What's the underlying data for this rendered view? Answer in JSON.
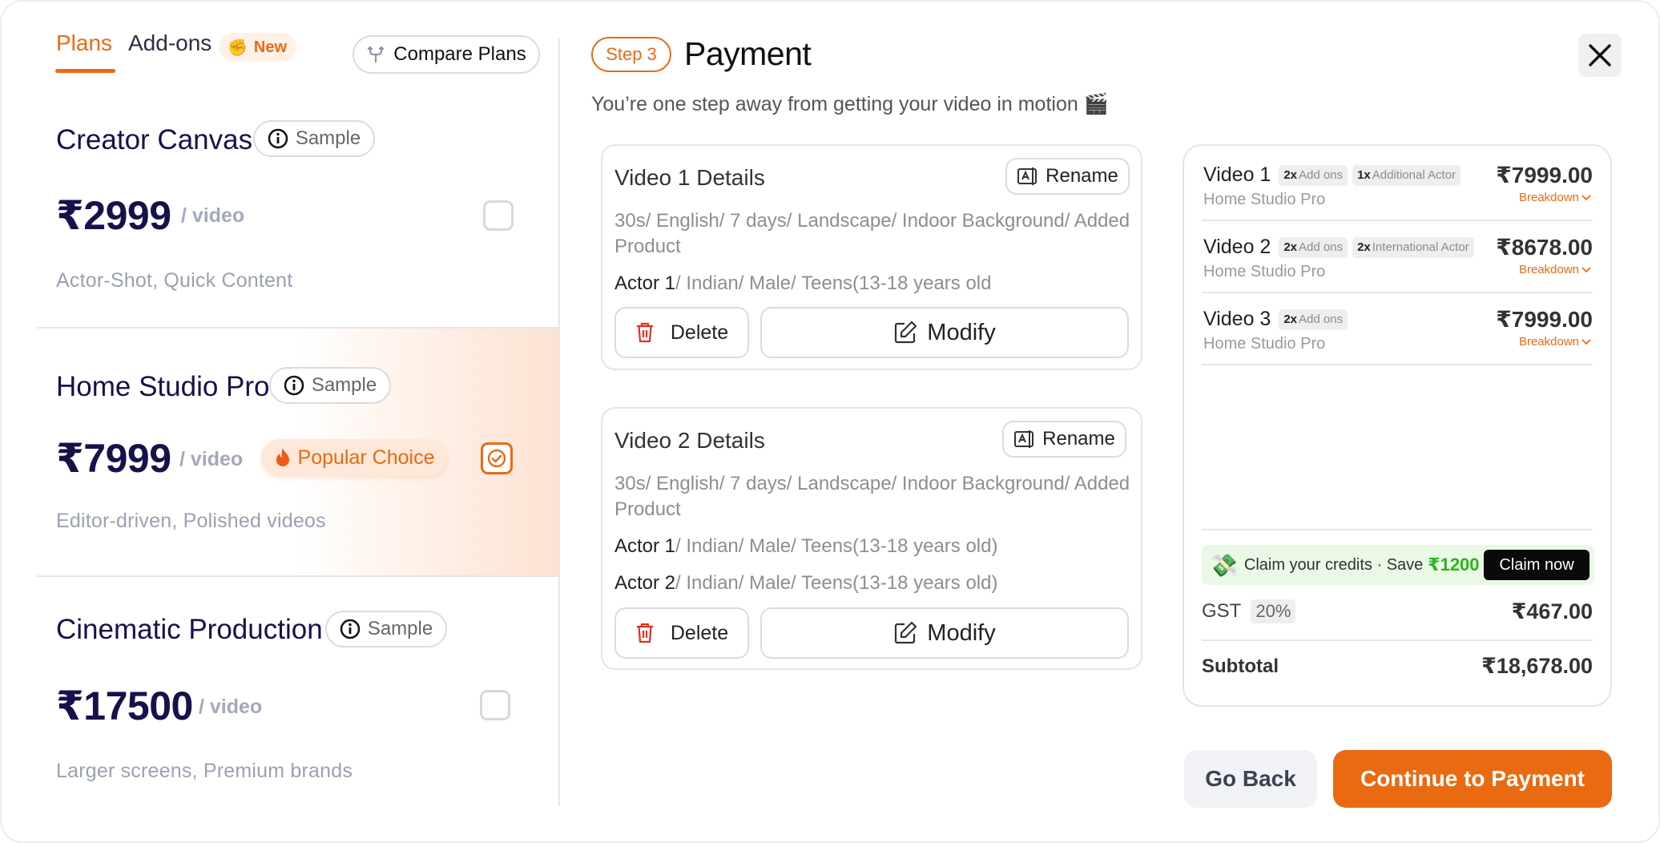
{
  "tabs": {
    "plans": "Plans",
    "addons": "Add-ons",
    "new_badge": "New"
  },
  "compare_label": "Compare Plans",
  "sample_label": "Sample",
  "per_video": "/ video",
  "popular_label": "Popular Choice",
  "plans": [
    {
      "name": "Creator Canvas",
      "price": "₹2999",
      "desc": "Actor-Shot, Quick Content",
      "selected": false
    },
    {
      "name": "Home Studio Pro",
      "price": "₹7999",
      "desc": "Editor-driven, Polished videos",
      "selected": true
    },
    {
      "name": "Cinematic Production",
      "price": "₹17500",
      "desc": "Larger screens, Premium brands",
      "selected": false
    }
  ],
  "header": {
    "step": "Step 3",
    "title": "Payment",
    "subtitle": "You’re one step away from getting your video in motion 🎬"
  },
  "videos": [
    {
      "title": "Video 1 Details",
      "spec_line1": "30s/ English/ 7 days/ Landscape/ Indoor Background/ Added",
      "spec_line2": "Product",
      "actors": [
        {
          "label": "Actor 1",
          "detail": "/ Indian/ Male/ Teens(13-18 years old"
        }
      ]
    },
    {
      "title": "Video 2 Details",
      "spec_line1": "30s/ English/ 7 days/ Landscape/ Indoor Background/ Added",
      "spec_line2": "Product",
      "actors": [
        {
          "label": "Actor 1",
          "detail": "/ Indian/ Male/ Teens(13-18 years old)"
        },
        {
          "label": "Actor 2",
          "detail": "/ Indian/ Male/ Teens(13-18 years old)"
        }
      ]
    }
  ],
  "buttons": {
    "rename": "Rename",
    "delete": "Delete",
    "modify": "Modify",
    "go_back": "Go Back",
    "continue": "Continue to Payment",
    "claim": "Claim now"
  },
  "summary": {
    "items": [
      {
        "name": "Video 1",
        "plan": "Home Studio Pro",
        "price": "₹7999.00",
        "chips": [
          {
            "count": "2x",
            "label": "Add ons"
          },
          {
            "count": "1x",
            "label": "Additional Actor"
          }
        ],
        "breakdown": "Breakdown"
      },
      {
        "name": "Video 2",
        "plan": "Home Studio Pro",
        "price": "₹8678.00",
        "chips": [
          {
            "count": "2x",
            "label": "Add ons"
          },
          {
            "count": "2x",
            "label": "International Actor"
          }
        ],
        "breakdown": "Breakdown"
      },
      {
        "name": "Video 3",
        "plan": "Home Studio Pro",
        "price": "₹7999.00",
        "chips": [
          {
            "count": "2x",
            "label": "Add ons"
          }
        ],
        "breakdown": "Breakdown"
      }
    ],
    "credits_text": "Claim your credits · Save",
    "credits_amount": "₹1200",
    "gst_label": "GST",
    "gst_rate": "20%",
    "gst_value": "₹467.00",
    "subtotal_label": "Subtotal",
    "subtotal_value": "₹18,678.00"
  },
  "colors": {
    "accent": "#ea6a12",
    "navy": "#15124b",
    "claim_bg": "#e9f9e6",
    "credit_green": "#2bb51b"
  }
}
